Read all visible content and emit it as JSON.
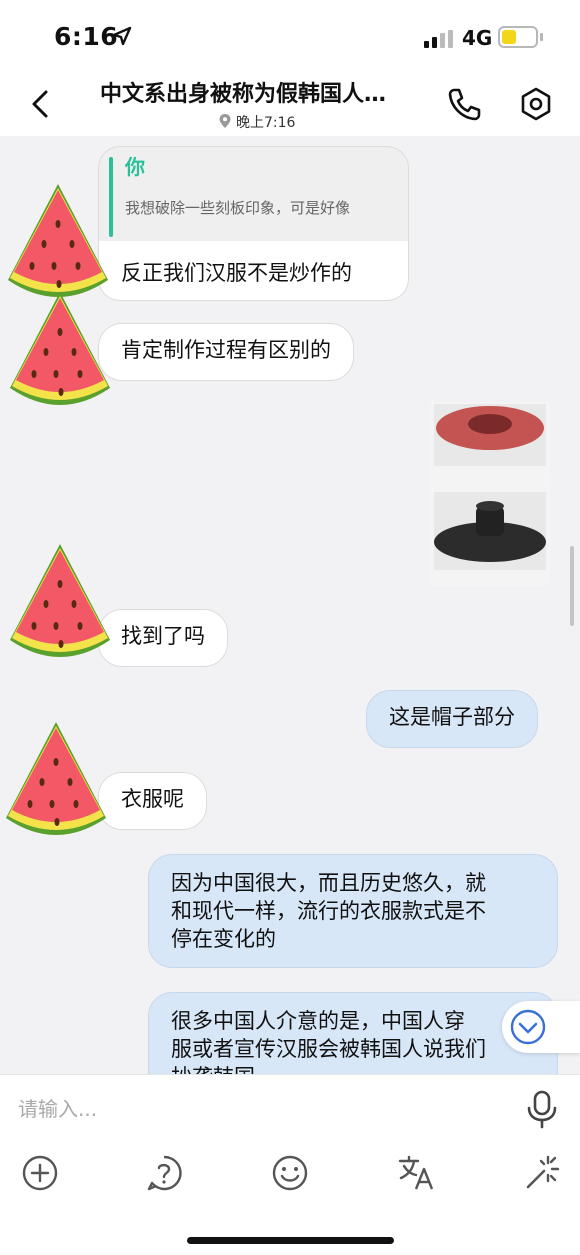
{
  "status_bar": {
    "time": "6:16",
    "network": "4G",
    "location_icon": "location-arrow-icon",
    "signal_icon": "signal-bars-icon",
    "battery_icon": "battery-icon",
    "battery_color": "#f3d51a"
  },
  "header": {
    "title": "中文系出身被称为假韩国人…",
    "subtitle": "晚上7:16",
    "back_icon": "chevron-left-icon",
    "call_icon": "phone-icon",
    "settings_icon": "hexagon-gear-icon",
    "location_pin_icon": "location-pin-icon"
  },
  "messages": [
    {
      "side": "left",
      "quote": {
        "author": "你",
        "text": "我想破除一些刻板印象，可是好像"
      },
      "text": "反正我们汉服不是炒作的"
    },
    {
      "side": "left",
      "text": "肯定制作过程有区别的"
    },
    {
      "side": "right",
      "type": "image",
      "description_icon": "hat-image"
    },
    {
      "side": "left",
      "text": "找到了吗"
    },
    {
      "side": "right",
      "text": "这是帽子部分"
    },
    {
      "side": "left",
      "text": "衣服呢"
    },
    {
      "side": "right",
      "lines": [
        "因为中国很大，而且历史悠久，就",
        "和现代一样，流行的衣服款式是不",
        "停在变化的"
      ]
    },
    {
      "side": "right",
      "lines": [
        "很多中国人介意的是，中国人穿",
        "服或者宣传汉服会被韩国人说我们",
        "抄袭韩国"
      ]
    }
  ],
  "avatar_icon": "watermelon-slice-icon",
  "scroll_down_icon": "chevron-down-circle-icon",
  "input": {
    "placeholder": "请输入...",
    "value": "",
    "mic_icon": "microphone-icon"
  },
  "toolbar": [
    {
      "name": "plus-circle-icon"
    },
    {
      "name": "question-circle-icon"
    },
    {
      "name": "smiley-icon"
    },
    {
      "name": "translate-icon"
    },
    {
      "name": "sparkle-icon"
    }
  ],
  "colors": {
    "accent_green": "#2bbf9a",
    "my_bubble": "#d8e7f8",
    "their_bubble": "#ffffff",
    "chat_background": "#f2f2f4"
  }
}
